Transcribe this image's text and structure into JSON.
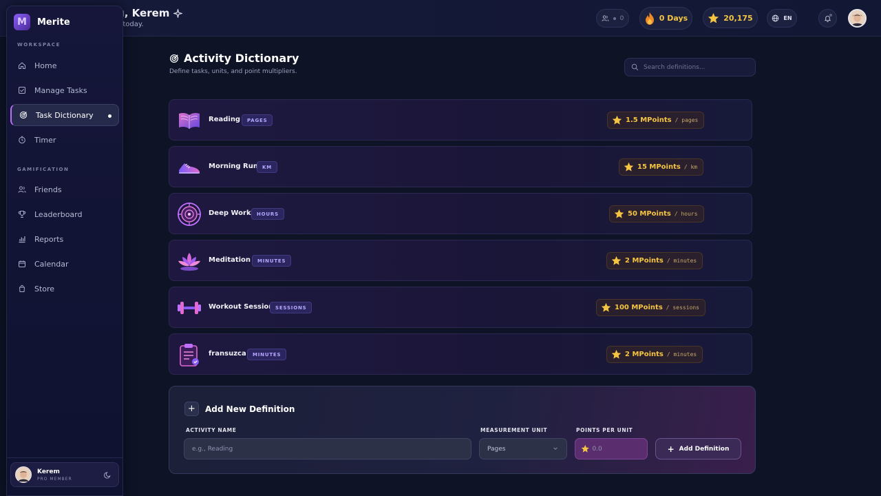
{
  "header": {
    "greeting_title": "g, Kerem",
    "greeting_sub": "s today.",
    "friends_count": "0",
    "streak_label": "0 Days",
    "points_label": "20,175",
    "language": "EN"
  },
  "sidebar": {
    "brand": "Merite",
    "workspace_label": "WORKSPACE",
    "gamification_label": "GAMIFICATION",
    "items": [
      {
        "label": "Home",
        "icon": "home-icon"
      },
      {
        "label": "Manage Tasks",
        "icon": "tasks-icon"
      },
      {
        "label": "Task Dictionary",
        "icon": "target-icon"
      },
      {
        "label": "Timer",
        "icon": "timer-icon"
      },
      {
        "label": "Friends",
        "icon": "friends-icon"
      },
      {
        "label": "Leaderboard",
        "icon": "trophy-icon"
      },
      {
        "label": "Reports",
        "icon": "reports-icon"
      },
      {
        "label": "Calendar",
        "icon": "calendar-icon"
      },
      {
        "label": "Store",
        "icon": "store-icon"
      }
    ],
    "user": {
      "name": "Kerem",
      "role": "PRO MEMBER"
    }
  },
  "main": {
    "title": "Activity Dictionary",
    "subtitle": "Define tasks, units, and point multipliers.",
    "search_placeholder": "Search definitions...",
    "activities": [
      {
        "name": "Reading",
        "unit": "PAGES",
        "points": "1.5 MPoints",
        "per": "/ pages"
      },
      {
        "name": "Morning Run",
        "unit": "KM",
        "points": "15 MPoints",
        "per": "/ km"
      },
      {
        "name": "Deep Work",
        "unit": "HOURS",
        "points": "50 MPoints",
        "per": "/ hours"
      },
      {
        "name": "Meditation",
        "unit": "MINUTES",
        "points": "2 MPoints",
        "per": "/ minutes"
      },
      {
        "name": "Workout Session",
        "unit": "SESSIONS",
        "points": "100 MPoints",
        "per": "/ sessions"
      },
      {
        "name": "fransuzca",
        "unit": "MINUTES",
        "points": "2 MPoints",
        "per": "/ minutes"
      }
    ],
    "add_form": {
      "title": "Add New Definition",
      "name_label": "ACTIVITY NAME",
      "name_placeholder": "e.g., Reading",
      "unit_label": "MEASUREMENT UNIT",
      "unit_value": "Pages",
      "points_label": "POINTS PER UNIT",
      "points_placeholder": "0.0",
      "submit_label": "Add Definition"
    }
  },
  "colors": {
    "accent": "#c070ff",
    "gold": "#f5c542",
    "background": "#0e1326"
  }
}
